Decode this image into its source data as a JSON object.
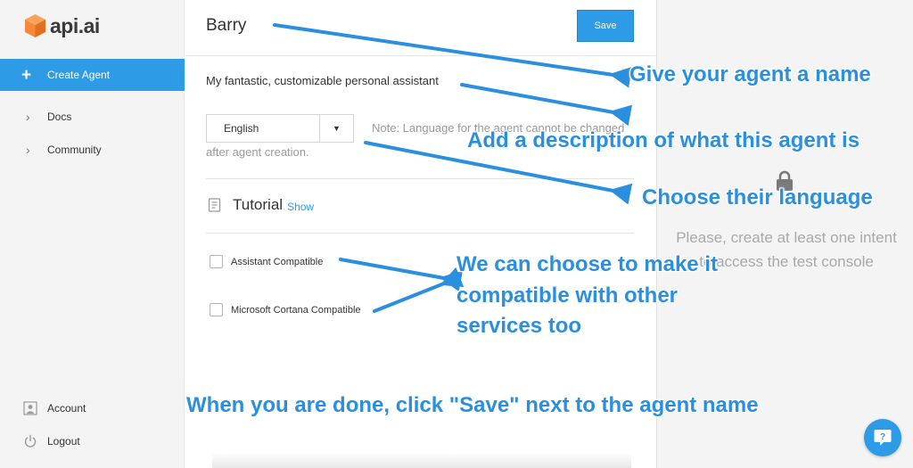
{
  "sidebar": {
    "logo_text": "api.ai",
    "create_agent": "Create Agent",
    "items": [
      {
        "label": "Docs"
      },
      {
        "label": "Community"
      }
    ],
    "bottom": [
      {
        "label": "Account",
        "icon": "person-icon"
      },
      {
        "label": "Logout",
        "icon": "power-icon"
      }
    ]
  },
  "main": {
    "agent_name": "Barry",
    "save_label": "Save",
    "description": "My fantastic, customizable personal assistant",
    "language": "English",
    "language_note": "Note: Language for the agent cannot be changed",
    "language_note_2": "after agent creation.",
    "tutorial_title": "Tutorial",
    "tutorial_show": "Show",
    "checkboxes": [
      {
        "label": "Assistant Compatible",
        "checked": false
      },
      {
        "label": "Microsoft Cortana Compatible",
        "checked": false
      }
    ]
  },
  "test_console": {
    "message": "Please, create at least one intent to access the test console"
  },
  "annotations": {
    "name": "Give your agent a name",
    "description": "Add a description of what this agent is",
    "language": "Choose their language",
    "compatible": "We can choose to make it compatible with other services too",
    "save": "When you are done, click \"Save\" next to the agent name"
  },
  "colors": {
    "accent": "#2d9be5",
    "annotation": "#2b8fe0",
    "logo": "#f5883a"
  }
}
